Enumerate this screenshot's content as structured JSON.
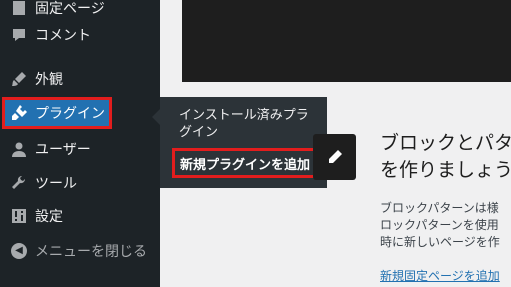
{
  "sidebar": {
    "items": [
      {
        "id": "fixed-page",
        "label": "固定ページ",
        "icon": "page-icon"
      },
      {
        "id": "comments",
        "label": "コメント",
        "icon": "comment-icon"
      },
      {
        "id": "appearance",
        "label": "外観",
        "icon": "brush-icon"
      },
      {
        "id": "plugins",
        "label": "プラグイン",
        "icon": "plugin-icon"
      },
      {
        "id": "users",
        "label": "ユーザー",
        "icon": "user-icon"
      },
      {
        "id": "tools",
        "label": "ツール",
        "icon": "wrench-icon"
      },
      {
        "id": "settings",
        "label": "設定",
        "icon": "sliders-icon"
      },
      {
        "id": "collapse",
        "label": "メニューを閉じる",
        "icon": "collapse-icon"
      }
    ]
  },
  "flyout": {
    "installed": "インストール済みプラグイン",
    "add_new": "新規プラグインを追加"
  },
  "main": {
    "title_line1": "ブロックとパタ",
    "title_line2": "を作りましょう",
    "body_line1": "ブロックパターンは様",
    "body_line2": "ロックパターンを使用",
    "body_line3": "時に新しいページを作",
    "link": "新規固定ページを追加"
  },
  "colors": {
    "sidebar_bg": "#1d2327",
    "active_bg": "#2271b1",
    "highlight_border": "#e21d1d",
    "flyout_bg": "#2c3338"
  }
}
